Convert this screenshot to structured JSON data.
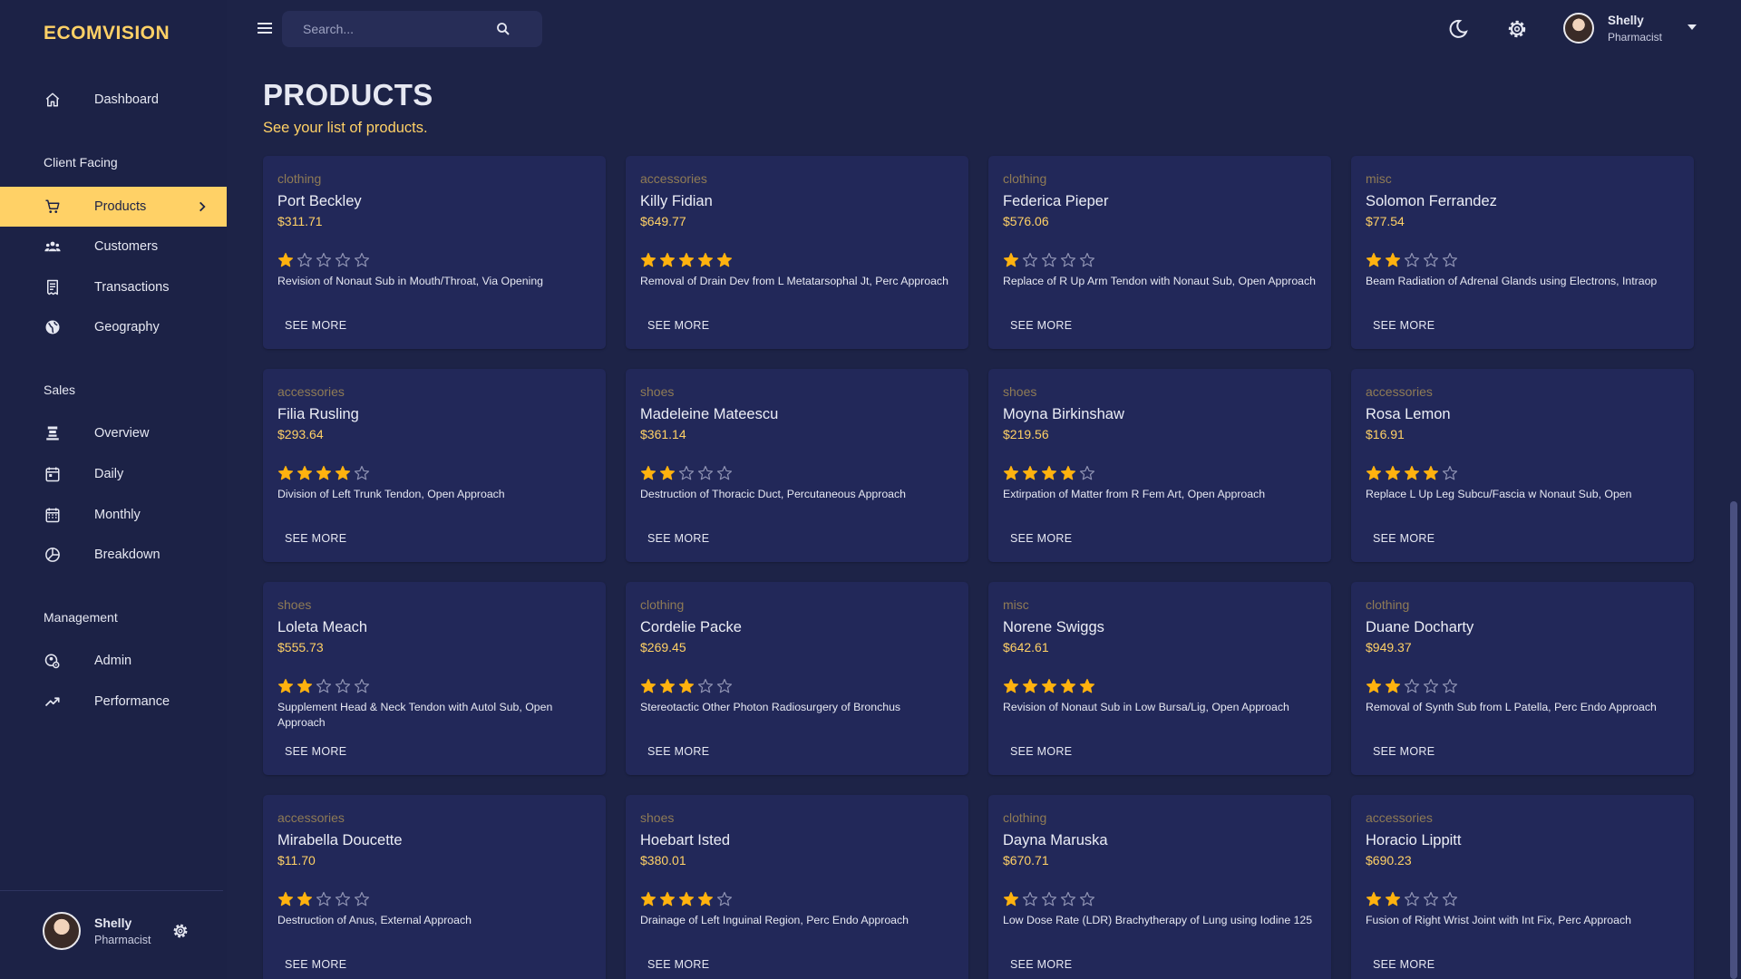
{
  "brand": "ECOMVISION",
  "nav": {
    "dashboard": "Dashboard",
    "section_client": "Client Facing",
    "products": "Products",
    "customers": "Customers",
    "transactions": "Transactions",
    "geography": "Geography",
    "section_sales": "Sales",
    "overview": "Overview",
    "daily": "Daily",
    "monthly": "Monthly",
    "breakdown": "Breakdown",
    "section_management": "Management",
    "admin": "Admin",
    "performance": "Performance",
    "active_item": "Products"
  },
  "user": {
    "name": "Shelly",
    "role": "Pharmacist"
  },
  "search": {
    "placeholder": "Search..."
  },
  "header": {
    "title": "PRODUCTS",
    "subtitle": "See your list of products."
  },
  "see_more_label": "SEE MORE",
  "colors": {
    "accent": "#ffd166",
    "background": "#1d2347",
    "card": "#222859",
    "star": "#ffb20f"
  },
  "icons": [
    "home-icon",
    "cart-icon",
    "customers-icon",
    "receipt-icon",
    "globe-icon",
    "overview-icon",
    "calendar-today-icon",
    "calendar-month-icon",
    "pie-chart-icon",
    "admin-icon",
    "trending-up-icon",
    "menu-icon",
    "search-icon",
    "moon-icon",
    "gear-icon",
    "chevron-right-icon",
    "caret-down-icon"
  ],
  "products": [
    {
      "category": "clothing",
      "name": "Port Beckley",
      "price": "$311.71",
      "rating": 1,
      "description": "Revision of Nonaut Sub in Mouth/Throat, Via Opening"
    },
    {
      "category": "accessories",
      "name": "Killy Fidian",
      "price": "$649.77",
      "rating": 5,
      "description": "Removal of Drain Dev from L Metatarsophal Jt, Perc Approach"
    },
    {
      "category": "clothing",
      "name": "Federica Pieper",
      "price": "$576.06",
      "rating": 1,
      "description": "Replace of R Up Arm Tendon with Nonaut Sub, Open Approach"
    },
    {
      "category": "misc",
      "name": "Solomon Ferrandez",
      "price": "$77.54",
      "rating": 2,
      "description": "Beam Radiation of Adrenal Glands using Electrons, Intraop"
    },
    {
      "category": "accessories",
      "name": "Filia Rusling",
      "price": "$293.64",
      "rating": 4,
      "description": "Division of Left Trunk Tendon, Open Approach"
    },
    {
      "category": "shoes",
      "name": "Madeleine Mateescu",
      "price": "$361.14",
      "rating": 2,
      "description": "Destruction of Thoracic Duct, Percutaneous Approach"
    },
    {
      "category": "shoes",
      "name": "Moyna Birkinshaw",
      "price": "$219.56",
      "rating": 4,
      "description": "Extirpation of Matter from R Fem Art, Open Approach"
    },
    {
      "category": "accessories",
      "name": "Rosa Lemon",
      "price": "$16.91",
      "rating": 4,
      "description": "Replace L Up Leg Subcu/Fascia w Nonaut Sub, Open"
    },
    {
      "category": "shoes",
      "name": "Loleta Meach",
      "price": "$555.73",
      "rating": 2,
      "description": "Supplement Head & Neck Tendon with Autol Sub, Open Approach"
    },
    {
      "category": "clothing",
      "name": "Cordelie Packe",
      "price": "$269.45",
      "rating": 3,
      "description": "Stereotactic Other Photon Radiosurgery of Bronchus"
    },
    {
      "category": "misc",
      "name": "Norene Swiggs",
      "price": "$642.61",
      "rating": 5,
      "description": "Revision of Nonaut Sub in Low Bursa/Lig, Open Approach"
    },
    {
      "category": "clothing",
      "name": "Duane Docharty",
      "price": "$949.37",
      "rating": 2,
      "description": "Removal of Synth Sub from L Patella, Perc Endo Approach"
    },
    {
      "category": "accessories",
      "name": "Mirabella Doucette",
      "price": "$11.70",
      "rating": 2,
      "description": "Destruction of Anus, External Approach"
    },
    {
      "category": "shoes",
      "name": "Hoebart Isted",
      "price": "$380.01",
      "rating": 4,
      "description": "Drainage of Left Inguinal Region, Perc Endo Approach"
    },
    {
      "category": "clothing",
      "name": "Dayna Maruska",
      "price": "$670.71",
      "rating": 1,
      "description": "Low Dose Rate (LDR) Brachytherapy of Lung using Iodine 125"
    },
    {
      "category": "accessories",
      "name": "Horacio Lippitt",
      "price": "$690.23",
      "rating": 2,
      "description": "Fusion of Right Wrist Joint with Int Fix, Perc Approach"
    }
  ]
}
